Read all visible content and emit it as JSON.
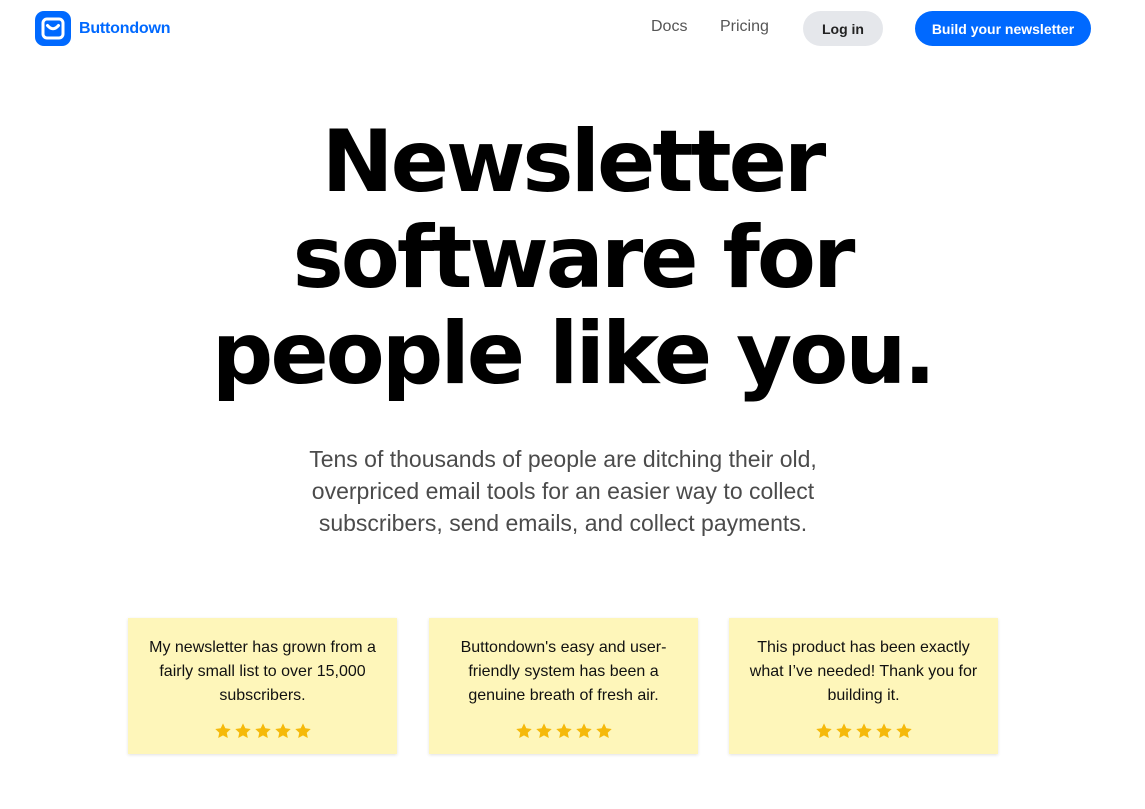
{
  "brand": {
    "name": "Buttondown",
    "color": "#0069ff",
    "icon": "buttondown-logo-icon"
  },
  "nav": {
    "docs": "Docs",
    "pricing": "Pricing",
    "login": "Log in",
    "cta": "Build your newsletter"
  },
  "hero": {
    "title_lines": [
      "Newsletter",
      "software for",
      "people like you."
    ],
    "subtitle_lines": [
      "Tens of thousands of people are ditching their old,",
      "overpriced email tools for an easier way to collect",
      "subscribers, send emails, and collect payments."
    ]
  },
  "testimonials": [
    {
      "lines": [
        "My newsletter has grown from a",
        "fairly small list to over 15,000",
        "subscribers."
      ],
      "rating": 5
    },
    {
      "lines": [
        "Buttondown's easy and user-",
        "friendly system has been a",
        "genuine breath of fresh air."
      ],
      "rating": 5
    },
    {
      "lines": [
        "This product has been exactly",
        "what I’ve needed! Thank you for",
        "building it."
      ],
      "rating": 5
    }
  ],
  "colors": {
    "card_bg": "#fef6ba",
    "star": "#f5b90a",
    "login_bg": "#e5e7eb"
  }
}
